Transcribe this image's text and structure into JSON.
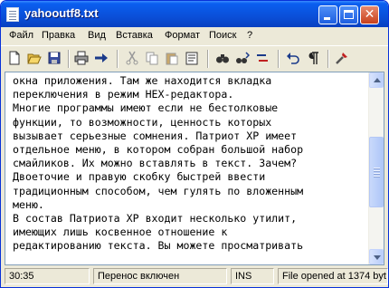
{
  "window": {
    "title": "yahooutf8.txt"
  },
  "menu": [
    "Файл",
    "Правка",
    "Вид",
    "Вставка",
    "Формат",
    "Поиск",
    "?"
  ],
  "toolbar_icons": [
    "new-file-icon",
    "open-folder-icon",
    "save-icon",
    "print-icon",
    "send-icon",
    "cut-icon",
    "copy-icon",
    "paste-icon",
    "paste-special-icon",
    "find-icon",
    "find-next-icon",
    "replace-icon",
    "undo-icon",
    "paragraph-icon",
    "tools-icon"
  ],
  "editor": {
    "lines": [
      "окна приложения. Там же находится вкладка",
      "переключения в режим HEX-редактора.",
      "Многие программы имеют если не бестолковые",
      "функции, то возможности, ценность которых",
      "вызывает серьезные сомнения. Патриот XP имеет",
      "отдельное меню, в котором собран большой набор",
      "смайликов. Их можно вставлять в текст. Зачем?",
      "Двоеточие и правую скобку быстрей ввести",
      "традиционным способом, чем гулять по вложенным",
      "меню.",
      "В состав Патриота XP входит несколько утилит,",
      "имеющих лишь косвенное отношение к",
      "редактированию текста. Вы можете просматривать"
    ]
  },
  "status": {
    "position": "30:35",
    "wrap": "Перенос включен",
    "mode": "INS",
    "file_info": "File opened at  1374 byt"
  },
  "colors": {
    "titlebar": "#0a4fd8",
    "chrome": "#ece9d8",
    "close_button": "#c8401c",
    "scroll_thumb": "#b9cdf9"
  }
}
